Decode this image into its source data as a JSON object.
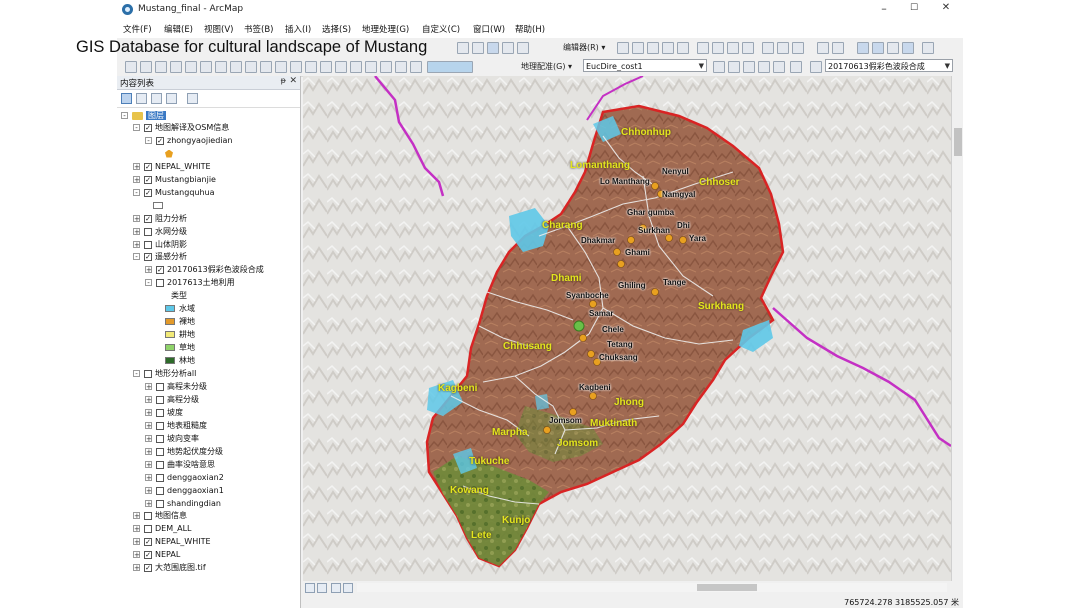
{
  "slide": {
    "title": "GIS Database for cultural landscape of Mustang"
  },
  "window": {
    "title": "Mustang_final - ArcMap",
    "minimize": "–",
    "maximize": "☐",
    "close": "✕"
  },
  "menu": [
    "文件(F)",
    "编辑(E)",
    "视图(V)",
    "书签(B)",
    "插入(I)",
    "选择(S)",
    "地理处理(G)",
    "自定义(C)",
    "窗口(W)",
    "帮助(H)"
  ],
  "toolbar": {
    "editor_label": "编辑器(R) ▾",
    "georef_label": "地理配准(G) ▾",
    "georef_layer": "EucDire_cost1",
    "layer_select": "20170613假彩色波段合成"
  },
  "toc": {
    "title": "内容列表",
    "pin": "ᵽ",
    "close": "✕",
    "root": "图层",
    "items": [
      {
        "label": "地图解译及OSM信息",
        "indent": 1,
        "exp": "-",
        "checked": true
      },
      {
        "label": "zhongyaojiedian",
        "indent": 2,
        "exp": "-",
        "checked": true
      },
      {
        "label": "NEPAL_WHITE",
        "indent": 1,
        "exp": "+",
        "checked": true
      },
      {
        "label": "Mustangbianjie",
        "indent": 1,
        "exp": "+",
        "checked": true
      },
      {
        "label": "Mustangquhua",
        "indent": 1,
        "exp": "-",
        "checked": true
      },
      {
        "label": "阻力分析",
        "indent": 1,
        "exp": "+",
        "checked": true
      },
      {
        "label": "水网分级",
        "indent": 1,
        "exp": "+",
        "checked": false
      },
      {
        "label": "山体阴影",
        "indent": 1,
        "exp": "+",
        "checked": false
      },
      {
        "label": "遥感分析",
        "indent": 1,
        "exp": "-",
        "checked": true
      },
      {
        "label": "20170613假彩色波段合成",
        "indent": 2,
        "exp": "+",
        "checked": true
      },
      {
        "label": "2017613土地利用",
        "indent": 2,
        "exp": "-",
        "checked": false
      },
      {
        "label": "地形分析all",
        "indent": 1,
        "exp": "-",
        "checked": false
      },
      {
        "label": "高程未分级",
        "indent": 2,
        "exp": "+",
        "checked": false
      },
      {
        "label": "高程分级",
        "indent": 2,
        "exp": "+",
        "checked": false
      },
      {
        "label": "坡度",
        "indent": 2,
        "exp": "+",
        "checked": false
      },
      {
        "label": "地表粗糙度",
        "indent": 2,
        "exp": "+",
        "checked": false
      },
      {
        "label": "坡向变率",
        "indent": 2,
        "exp": "+",
        "checked": false
      },
      {
        "label": "地势起伏度分级",
        "indent": 2,
        "exp": "+",
        "checked": false
      },
      {
        "label": "曲率没啥意思",
        "indent": 2,
        "exp": "+",
        "checked": false
      },
      {
        "label": "denggaoxian2",
        "indent": 2,
        "exp": "+",
        "checked": false
      },
      {
        "label": "denggaoxian1",
        "indent": 2,
        "exp": "+",
        "checked": false
      },
      {
        "label": "shandingdian",
        "indent": 2,
        "exp": "+",
        "checked": false
      },
      {
        "label": "地图信息",
        "indent": 1,
        "exp": "+",
        "checked": false
      },
      {
        "label": "DEM_ALL",
        "indent": 1,
        "exp": "+",
        "checked": false
      },
      {
        "label": "NEPAL_WHITE",
        "indent": 1,
        "exp": "+",
        "checked": true
      },
      {
        "label": "NEPAL",
        "indent": 1,
        "exp": "+",
        "checked": true
      },
      {
        "label": "大范围底图.tif",
        "indent": 1,
        "exp": "+",
        "checked": true
      }
    ],
    "legend_title": "类型",
    "legend": [
      {
        "label": "水域",
        "color": "#5ec8e8"
      },
      {
        "label": "裸地",
        "color": "#e39a2a"
      },
      {
        "label": "耕地",
        "color": "#f2ea78"
      },
      {
        "label": "草地",
        "color": "#8fd36a"
      },
      {
        "label": "林地",
        "color": "#2e6b2a"
      }
    ]
  },
  "map": {
    "regions": [
      "Chhonhup",
      "Lomanthang",
      "Chhoser",
      "Charang",
      "Dhami",
      "Surkhang",
      "Chhusang",
      "Kagbeni",
      "Jhong",
      "Marpha",
      "Muktinath",
      "Jomsom",
      "Tukuche",
      "Kowang",
      "Kunjo",
      "Lete"
    ],
    "places": [
      "Nenyul",
      "Lo Manthang",
      "Namgyal",
      "Ghar gumba",
      "Surkhan",
      "Dhi",
      "Dhakmar",
      "Yara",
      "Ghami",
      "Tange",
      "Ghiling",
      "Syanboche",
      "Samar",
      "Chele",
      "Tetang",
      "Chuksang",
      "Kagbeni",
      "Jomsom"
    ]
  },
  "status": {
    "coordinates": "765724.278  3185525.057 米"
  }
}
